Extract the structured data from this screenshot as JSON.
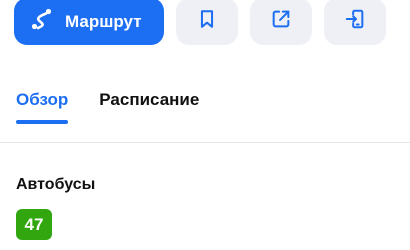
{
  "actions": {
    "route_label": "Маршрут",
    "route_icon": "route-icon",
    "bookmark_icon": "bookmark-icon",
    "share_icon": "share-icon",
    "send_to_phone_icon": "send-to-phone-icon"
  },
  "tabs": [
    {
      "label": "Обзор",
      "active": true
    },
    {
      "label": "Расписание",
      "active": false
    }
  ],
  "transport": {
    "section_title": "Автобусы",
    "routes": [
      {
        "number": "47",
        "color": "#31a60f"
      }
    ]
  },
  "colors": {
    "accent": "#1c6ef2",
    "secondary_button": "#eef0f5",
    "bus_route": "#31a60f"
  }
}
